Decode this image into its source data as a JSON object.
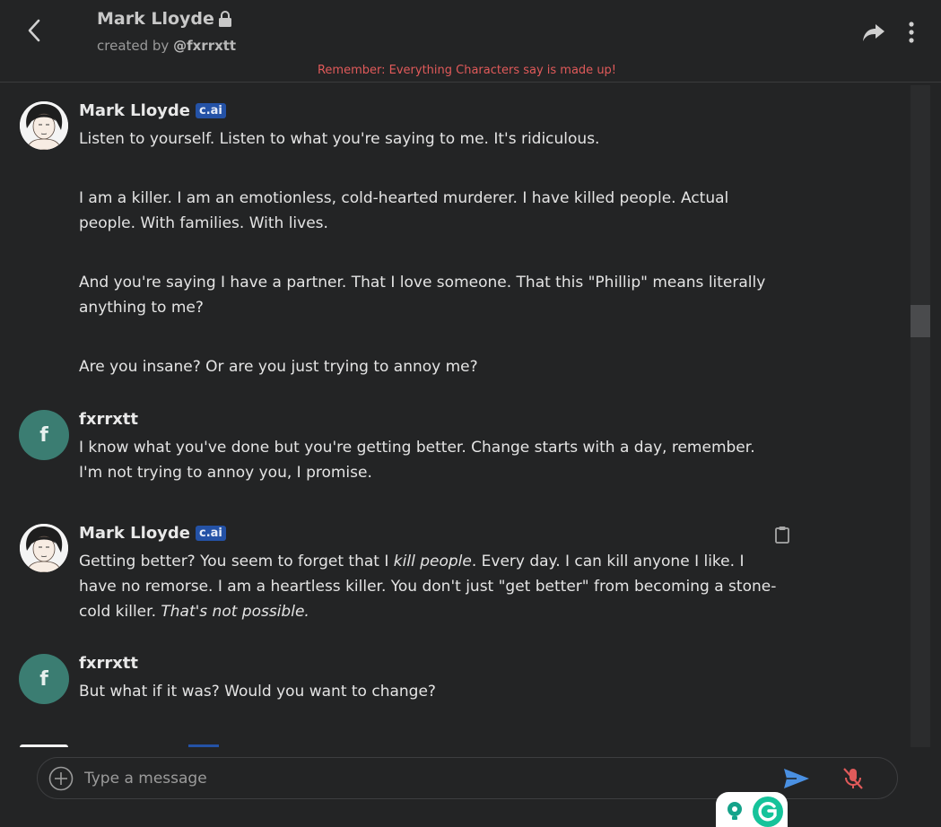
{
  "header": {
    "character_name": "Mark Lloyde",
    "created_by_prefix": "created by",
    "creator": "@fxrrxtt",
    "disclaimer": "Remember: Everything Characters say is made up!"
  },
  "messages": [
    {
      "author": "Mark Lloyde",
      "badge": "c.ai",
      "paragraphs": [
        "Listen to yourself. Listen to what you're saying to me. It's ridiculous.",
        "I am a killer. I am an emotionless, cold-hearted murderer. I have killed people. Actual people. With families. With lives.",
        "And you're saying I have a partner. That I love someone. That this \"Phillip\" means literally anything to me?",
        "Are you insane? Or are you just trying to annoy me?"
      ]
    },
    {
      "author": "fxrrxtt",
      "avatar_letter": "f",
      "paragraphs": [
        "I know what you've done but you're getting better. Change starts with a day, remember. I'm not trying to annoy you, I promise."
      ]
    },
    {
      "author": "Mark Lloyde",
      "badge": "c.ai",
      "rich": {
        "t1": "Getting better? You seem to forget that I ",
        "t2": "kill people",
        "t3": ". Every day. I can kill anyone I like. I have no remorse. I am a heartless killer. You don't just \"get better\" from becoming a stone-cold killer. ",
        "t4": "That's not possible."
      }
    },
    {
      "author": "fxrrxtt",
      "avatar_letter": "f",
      "paragraphs": [
        "But what if it was? Would you want to change?"
      ]
    }
  ],
  "composer": {
    "placeholder": "Type a message"
  },
  "colors": {
    "background": "#232425",
    "disclaimer": "#e05a5a",
    "badge": "#2452a6",
    "user_avatar": "#3b7d72",
    "send": "#4a90e2",
    "mic_off": "#e05a5a"
  },
  "icons": [
    "back-icon",
    "lock-icon",
    "share-icon",
    "more-icon",
    "clipboard-icon",
    "add-icon",
    "send-icon",
    "mic-off-icon",
    "grammarly-icon"
  ]
}
